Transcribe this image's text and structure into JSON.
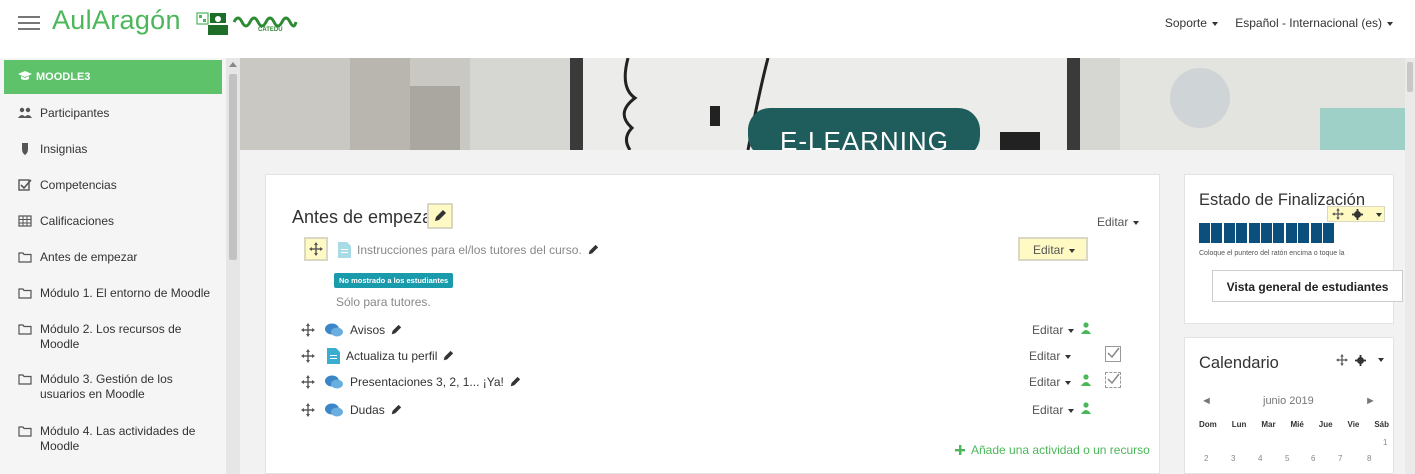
{
  "header": {
    "brand": "AulAragón",
    "brand_sub": "CATEDU",
    "support": "Soporte",
    "language": "Español - Internacional (es)"
  },
  "sidebar": {
    "course": "MOODLE3",
    "items": [
      {
        "label": "Participantes",
        "icon": "users-icon"
      },
      {
        "label": "Insignias",
        "icon": "shield-icon"
      },
      {
        "label": "Competencias",
        "icon": "checkbox-icon"
      },
      {
        "label": "Calificaciones",
        "icon": "grid-icon"
      },
      {
        "label": "Antes de empezar",
        "icon": "folder-icon"
      },
      {
        "label": "Módulo 1. El entorno de Moodle",
        "icon": "folder-icon"
      },
      {
        "label": "Módulo 2. Los recursos de Moodle",
        "icon": "folder-icon"
      },
      {
        "label": "Módulo 3. Gestión de los usuarios en Moodle",
        "icon": "folder-icon"
      },
      {
        "label": "Módulo 4. Las actividades de Moodle",
        "icon": "folder-icon"
      }
    ]
  },
  "banner": {
    "text": "E-LEARNING"
  },
  "section": {
    "title": "Antes de empezar",
    "edit_label": "Editar",
    "activities": [
      {
        "name": "Instrucciones para el/los tutores del curso.",
        "type": "page",
        "edit": "Editar"
      },
      {
        "name": "Avisos",
        "type": "forum",
        "edit": "Editar"
      },
      {
        "name": "Actualiza tu perfil",
        "type": "page",
        "edit": "Editar"
      },
      {
        "name": "Presentaciones 3, 2, 1... ¡Ya!",
        "type": "forum",
        "edit": "Editar"
      },
      {
        "name": "Dudas",
        "type": "forum",
        "edit": "Editar"
      }
    ],
    "hidden_badge": "No mostrado a los estudiantes",
    "tutors_note": "Sólo para tutores.",
    "add_activity": "Añade una actividad o un recurso"
  },
  "completion_block": {
    "title": "Estado de Finalización",
    "segments": 11,
    "note": "Coloque el puntero del ratón encima o toque la",
    "button": "Vista general de estudiantes"
  },
  "calendar_block": {
    "title": "Calendario",
    "month": "junio 2019",
    "days": [
      "Dom",
      "Lun",
      "Mar",
      "Mié",
      "Jue",
      "Vie",
      "Sáb"
    ],
    "week1": [
      "1"
    ],
    "week2": [
      "2",
      "3",
      "4",
      "5",
      "6",
      "7",
      "8"
    ]
  },
  "colors": {
    "brand_green": "#4cb75a",
    "sidebar_active": "#5ec26b",
    "progress_blue": "#0b4f7d",
    "badge_teal": "#1a9bab",
    "highlight_yellow": "#fff9c4"
  }
}
